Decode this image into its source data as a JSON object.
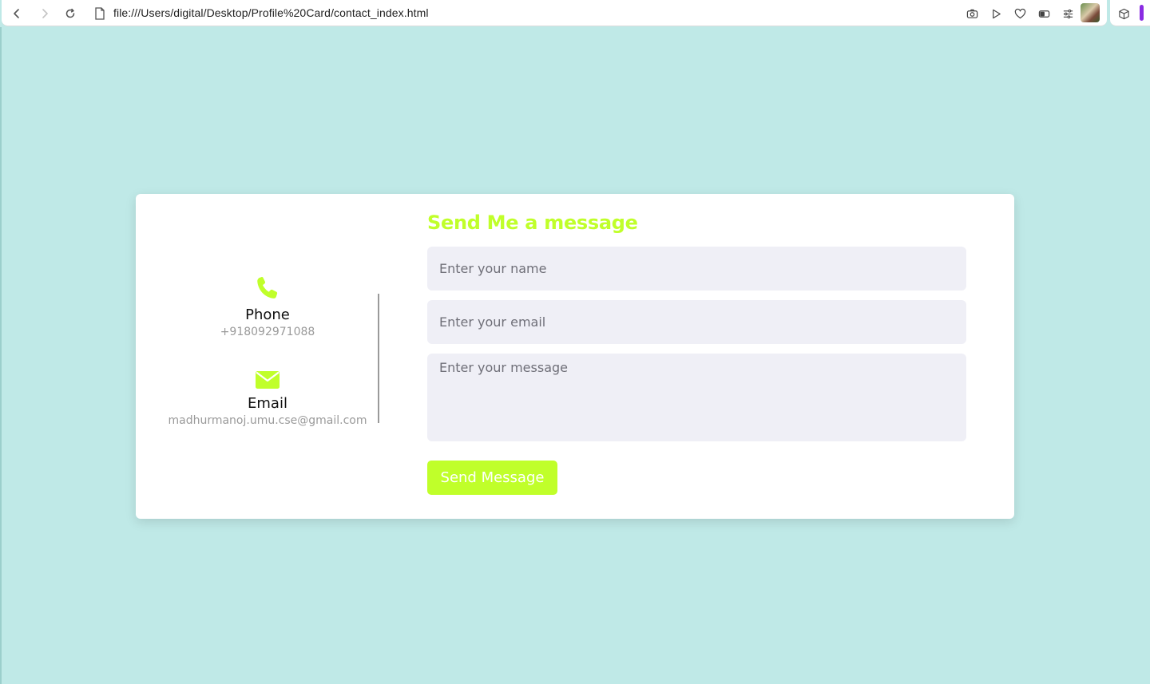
{
  "browser": {
    "url": "file:///Users/digital/Desktop/Profile%20Card/contact_index.html",
    "icons": [
      "back-icon",
      "forward-icon",
      "reload-icon",
      "page-icon",
      "camera-icon",
      "play-icon",
      "heart-icon",
      "toggle-icon",
      "sliders-icon",
      "avatar",
      "box-icon"
    ],
    "accent": "#8a2be2"
  },
  "contact": {
    "phone": {
      "title": "Phone",
      "value": "+918092971088",
      "icon": "phone-icon"
    },
    "email": {
      "title": "Email",
      "value": "madhurmanoj.umu.cse@gmail.com",
      "icon": "envelope-icon"
    }
  },
  "form": {
    "title": "Send Me a message",
    "name_placeholder": "Enter your name",
    "email_placeholder": "Enter your email",
    "message_placeholder": "Enter your message",
    "submit_label": "Send Message"
  },
  "colors": {
    "background": "#bfe9e7",
    "accent": "#c0ff2a",
    "field_bg": "#efeff6",
    "card": "#ffffff"
  }
}
